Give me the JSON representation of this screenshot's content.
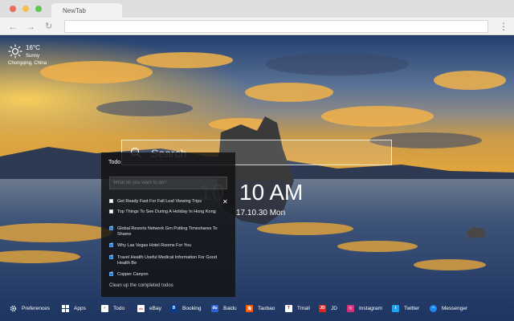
{
  "browser": {
    "tab_title": "NewTab",
    "address": ""
  },
  "weather": {
    "icon": "sun-icon",
    "temperature": "16°C",
    "condition": "Sunny",
    "location": "Chongqing, China"
  },
  "search": {
    "placeholder": "Search"
  },
  "clock": {
    "time": "10 AM",
    "date": "17.10.30 Mon"
  },
  "todo": {
    "title": "Todo",
    "input_placeholder": "What do you want to do?",
    "items": [
      {
        "text": "Get Ready Fast For Fall Leaf Viewing Trips",
        "done": false
      },
      {
        "text": "Top Things To See During A Holiday In Hong Kong",
        "done": false
      },
      {
        "text": "Global Resorts Network Grn Putting Timeshares To Shame",
        "done": true
      },
      {
        "text": "Why Las Vegas Hotel Rooms For You",
        "done": true
      },
      {
        "text": "Travel Health Useful Medical Information For Good Health Be",
        "done": true
      },
      {
        "text": "Copper Canyon",
        "done": true
      }
    ],
    "close_icon": "close-icon",
    "clean_label": "Clean up the completed todos"
  },
  "bottom_bar": {
    "items": [
      {
        "label": "Preferences",
        "icon": "gear-icon",
        "color": "#00000000"
      },
      {
        "label": "Apps",
        "icon": "grid-icon",
        "color": "#00000000"
      },
      {
        "label": "Todo",
        "icon": "checkbox-icon",
        "color": "#ffffff"
      },
      {
        "label": "eBay",
        "icon": "ebay-icon",
        "color": "#ffffff"
      },
      {
        "label": "Booking",
        "icon": "booking-icon",
        "color": "#0b3a8a"
      },
      {
        "label": "Baidu",
        "icon": "baidu-icon",
        "color": "#2a63d6"
      },
      {
        "label": "Taobao",
        "icon": "taobao-icon",
        "color": "#ff5a00"
      },
      {
        "label": "Tmall",
        "icon": "tmall-icon",
        "color": "#e1251b"
      },
      {
        "label": "JD",
        "icon": "jd-icon",
        "color": "#e1251b"
      },
      {
        "label": "Instagram",
        "icon": "instagram-icon",
        "color": "#d6307a"
      },
      {
        "label": "Twitter",
        "icon": "twitter-icon",
        "color": "#1da1f2"
      },
      {
        "label": "Messenger",
        "icon": "messenger-icon",
        "color": "#1d8bf2"
      }
    ]
  }
}
